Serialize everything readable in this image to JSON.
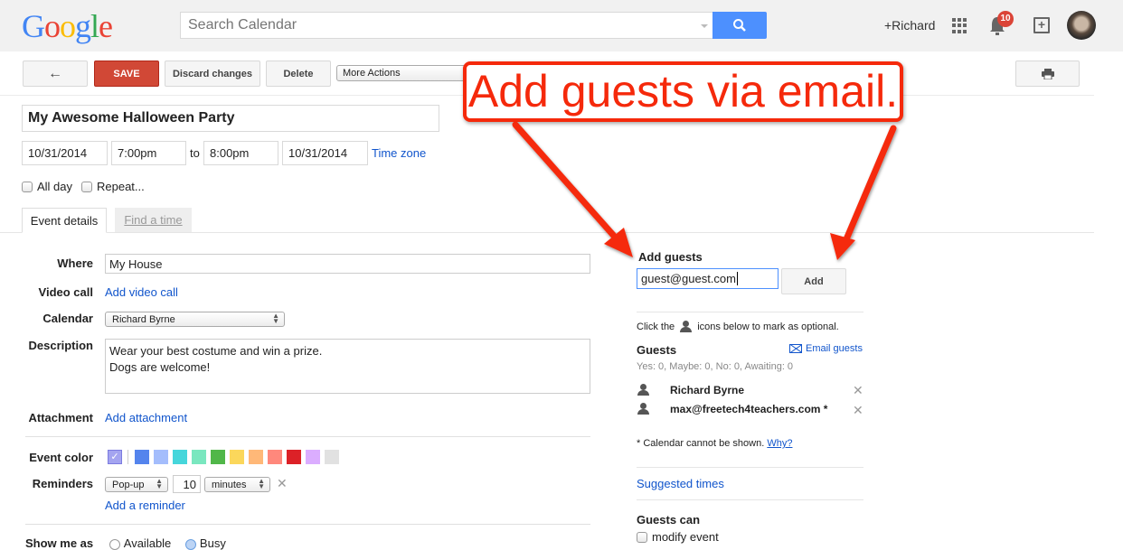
{
  "header": {
    "logo_letters": [
      "G",
      "o",
      "o",
      "g",
      "l",
      "e"
    ],
    "search_placeholder": "Search Calendar",
    "user_label": "+Richard",
    "notification_count": "10",
    "share_symbol": "+"
  },
  "toolbar": {
    "back_symbol": "←",
    "save_label": "SAVE",
    "discard_label": "Discard changes",
    "delete_label": "Delete",
    "more_actions_label": "More Actions",
    "print_symbol": "🖶"
  },
  "event": {
    "title": "My Awesome Halloween Party",
    "start_date": "10/31/2014",
    "start_time": "7:00pm",
    "to_label": "to",
    "end_time": "8:00pm",
    "end_date": "10/31/2014",
    "time_zone_link": "Time zone",
    "all_day_label": "All day",
    "repeat_label": "Repeat..."
  },
  "tabs": [
    {
      "label": "Event details",
      "active": true
    },
    {
      "label": "Find a time",
      "active": false
    }
  ],
  "details": {
    "where_label": "Where",
    "where_value": "My House",
    "video_label": "Video call",
    "video_link": "Add video call",
    "calendar_label": "Calendar",
    "calendar_value": "Richard Byrne",
    "description_label": "Description",
    "description_value": "Wear your best costume and win a prize.\nDogs are welcome!",
    "attachment_label": "Attachment",
    "attachment_link": "Add attachment",
    "color_label": "Event color",
    "colors": [
      "#5484ed",
      "#a4bdfc",
      "#46d6db",
      "#7ae7bf",
      "#51b749",
      "#fbd75b",
      "#ffb878",
      "#ff887c",
      "#dc2127",
      "#dbadff",
      "#e1e1e1"
    ],
    "selected_color": "#a4a4f0",
    "reminders_label": "Reminders",
    "reminder_type": "Pop-up",
    "reminder_value": "10",
    "reminder_unit": "minutes",
    "add_reminder_link": "Add a reminder",
    "show_me_as_label": "Show me as",
    "availability_options": [
      "Available",
      "Busy"
    ]
  },
  "guests_panel": {
    "add_guests_heading": "Add guests",
    "guest_input_value": "guest@guest.com",
    "add_button_label": "Add",
    "hint_prefix": "Click the",
    "hint_suffix": "icons below to mark as optional.",
    "guests_heading": "Guests",
    "email_guests_link": "Email guests",
    "rsvp_summary": "Yes: 0, Maybe: 0, No: 0, Awaiting: 0",
    "guests": [
      {
        "name": "Richard Byrne"
      },
      {
        "name": "max@freetech4teachers.com *"
      }
    ],
    "calendar_note": "* Calendar cannot be shown.",
    "why_link": "Why?",
    "suggested_times_link": "Suggested times",
    "guests_can_heading": "Guests can",
    "modify_event_label": "modify event"
  },
  "annotation": {
    "callout_text": "Add guests via email.",
    "color": "#f5290b"
  }
}
